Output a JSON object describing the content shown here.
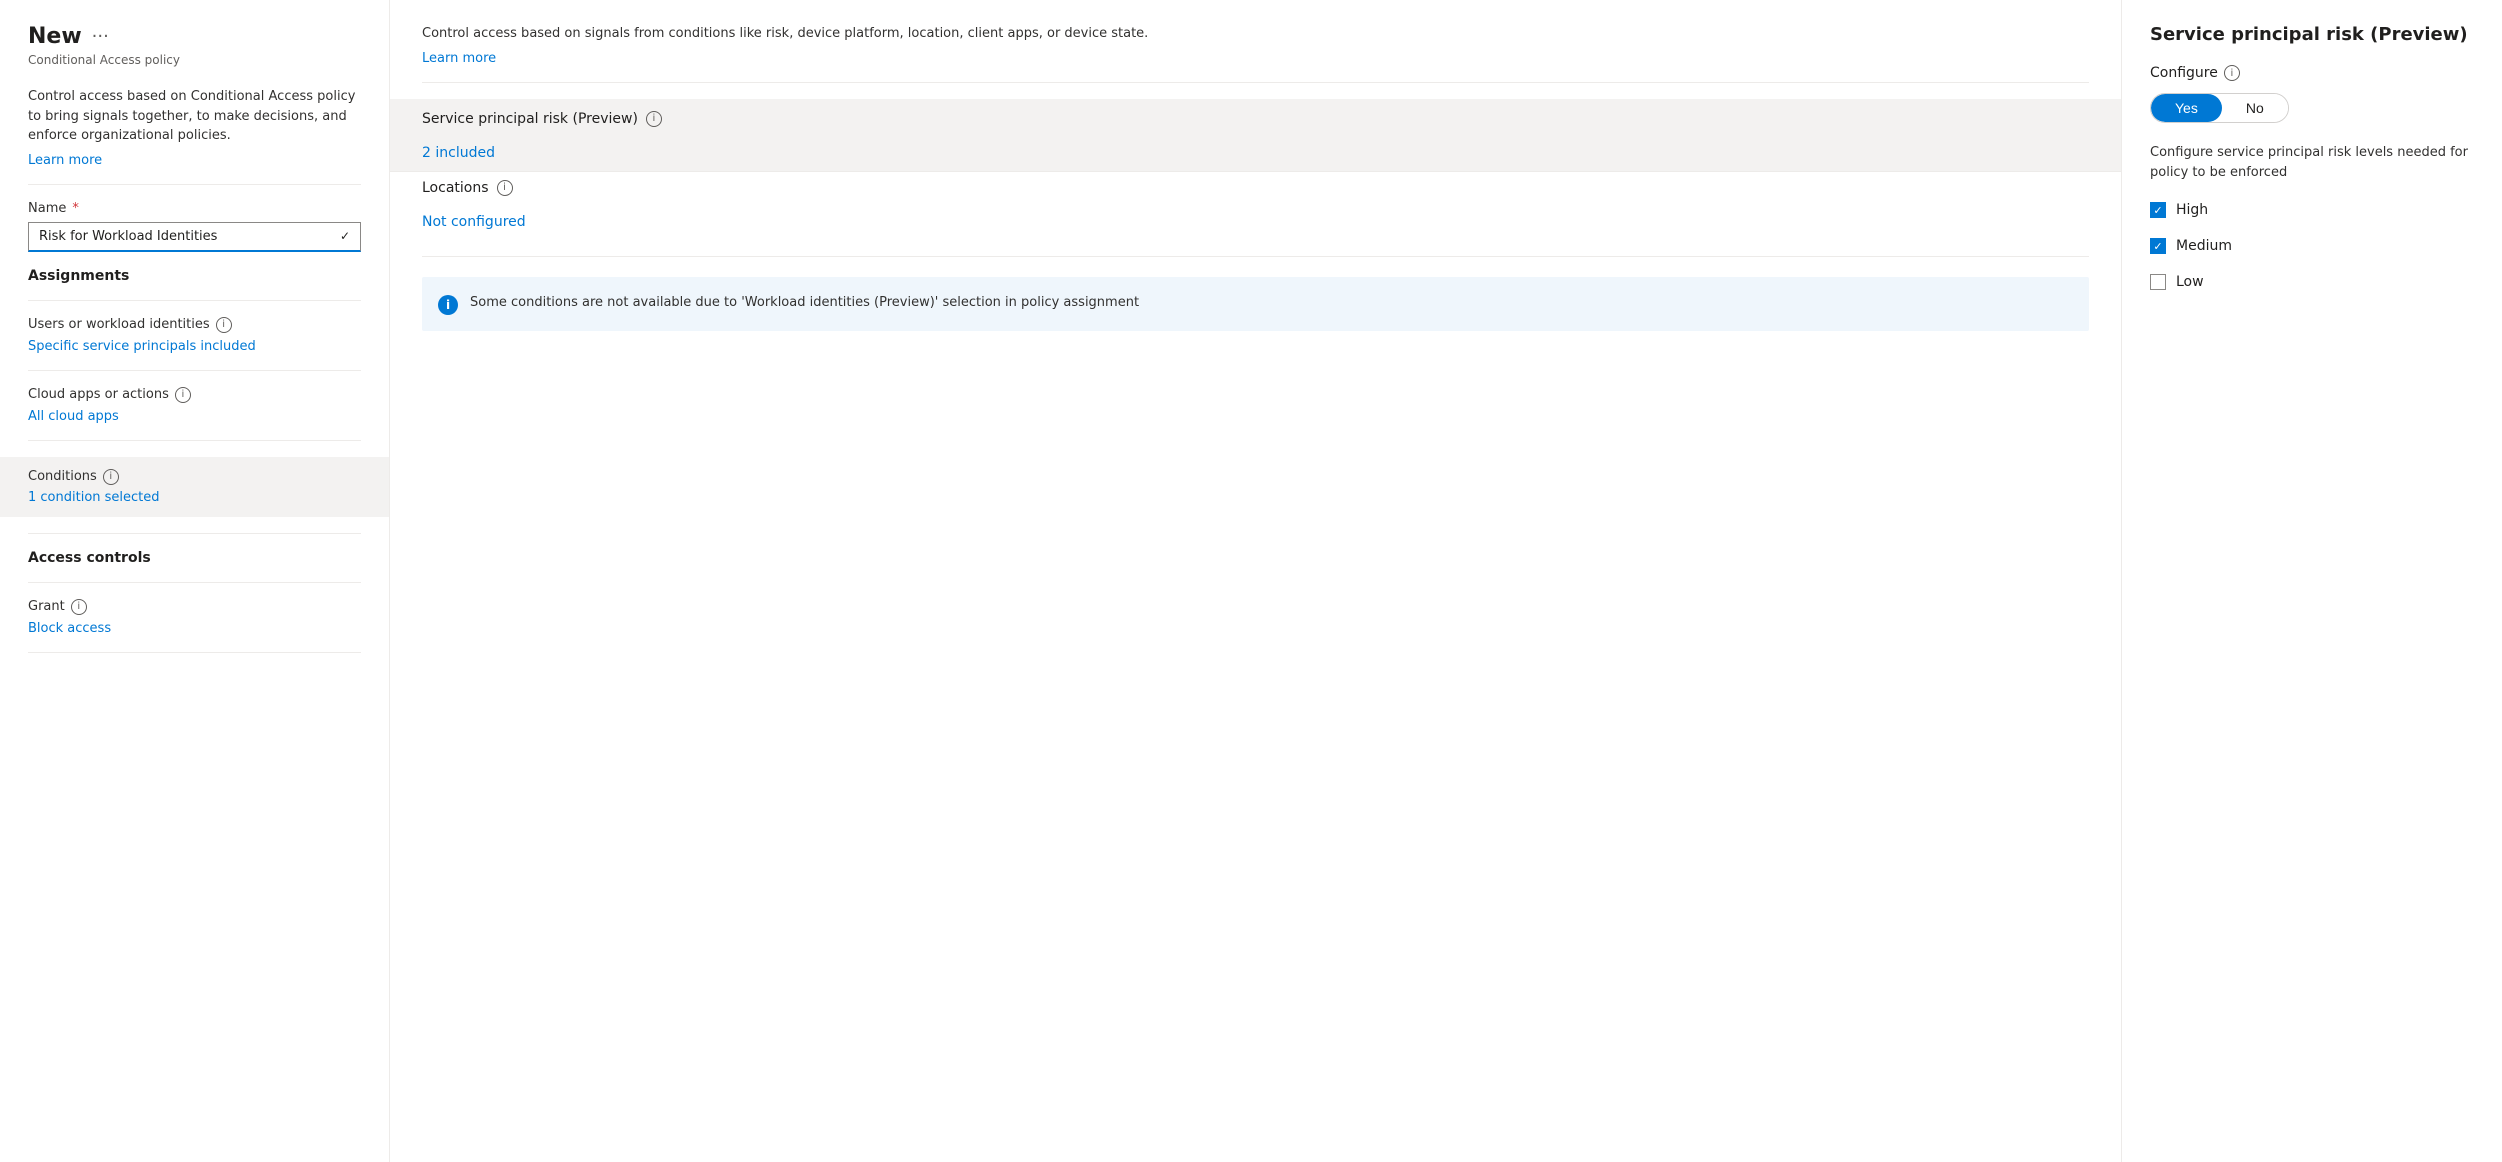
{
  "left": {
    "title": "New",
    "ellipsis": "···",
    "subtitle": "Conditional Access policy",
    "description": "Control access based on Conditional Access policy to bring signals together, to make decisions, and enforce organizational policies.",
    "learn_more": "Learn more",
    "name_label": "Name",
    "name_value": "Risk for Workload Identities",
    "assignments_label": "Assignments",
    "users_label": "Users or workload identities",
    "users_value": "Specific service principals included",
    "cloud_apps_label": "Cloud apps or actions",
    "cloud_apps_value": "All cloud apps",
    "conditions_label": "Conditions",
    "conditions_info": "ℹ",
    "conditions_value": "1 condition selected",
    "access_controls_label": "Access controls",
    "grant_label": "Grant",
    "grant_info": "ℹ",
    "grant_value": "Block access"
  },
  "middle": {
    "description": "Control access based on signals from conditions like risk, device platform, location, client apps, or device state.",
    "learn_more": "Learn more",
    "service_principal_label": "Service principal risk (Preview)",
    "service_principal_value": "2 included",
    "locations_label": "Locations",
    "locations_value": "Not configured",
    "info_box_text": "Some conditions are not available due to 'Workload identities (Preview)' selection in policy assignment"
  },
  "right": {
    "title": "Service principal risk (Preview)",
    "configure_label": "Configure",
    "yes_label": "Yes",
    "no_label": "No",
    "configure_desc": "Configure service principal risk levels needed for policy to be enforced",
    "checkboxes": [
      {
        "label": "High",
        "checked": true
      },
      {
        "label": "Medium",
        "checked": true
      },
      {
        "label": "Low",
        "checked": false
      }
    ]
  },
  "icons": {
    "info": "i",
    "chevron": "∨",
    "info_circle": "ℹ"
  }
}
